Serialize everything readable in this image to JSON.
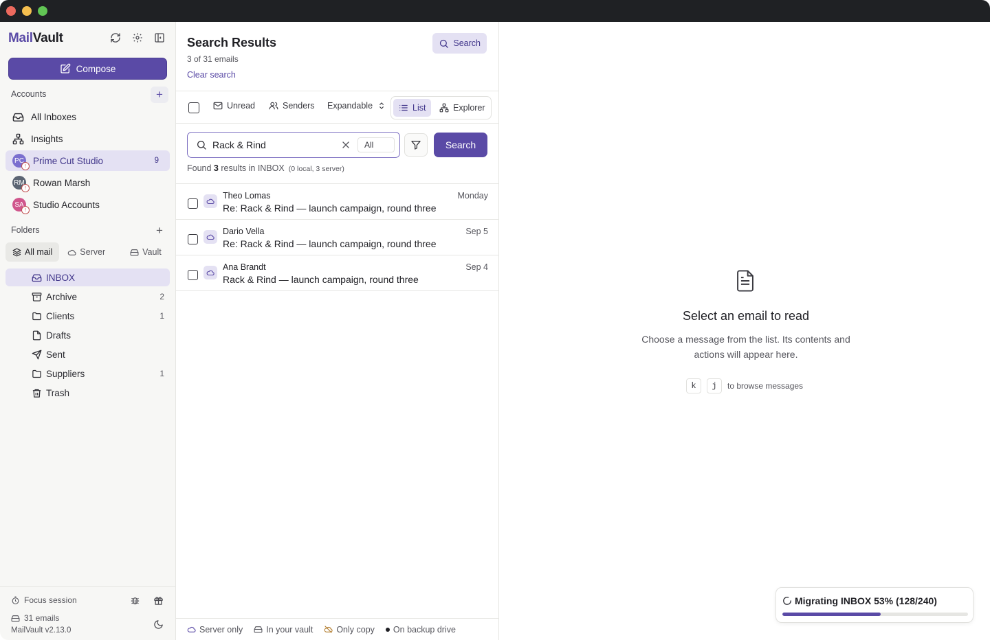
{
  "app": {
    "logo_mail": "Mail",
    "logo_vault": "Vault"
  },
  "sidebar": {
    "compose_label": "Compose",
    "accounts_label": "Accounts",
    "accounts": [
      {
        "label": "All Inboxes",
        "icon": "inbox-icon"
      },
      {
        "label": "Insights",
        "icon": "network-icon"
      },
      {
        "label": "Prime Cut Studio",
        "initials": "PC",
        "color": "#7b6fcf",
        "count": "9",
        "active": true
      },
      {
        "label": "Rowan Marsh",
        "initials": "RM",
        "color": "#5c6573"
      },
      {
        "label": "Studio Accounts",
        "initials": "SA",
        "color": "#d0568c"
      }
    ],
    "folders_label": "Folders",
    "folder_tabs": [
      "All mail",
      "Server",
      "Vault"
    ],
    "folders": [
      {
        "label": "INBOX",
        "icon": "inbox-icon",
        "count": ""
      },
      {
        "label": "Archive",
        "icon": "archive-icon",
        "count": "2"
      },
      {
        "label": "Clients",
        "icon": "folder-icon",
        "count": "1"
      },
      {
        "label": "Drafts",
        "icon": "file-icon",
        "count": ""
      },
      {
        "label": "Sent",
        "icon": "send-icon",
        "count": ""
      },
      {
        "label": "Suppliers",
        "icon": "folder-icon",
        "count": "1"
      },
      {
        "label": "Trash",
        "icon": "trash-icon",
        "count": ""
      }
    ],
    "footer": {
      "focus_label": "Focus session",
      "email_count": "31 emails",
      "version": "MailVault v2.13.0"
    }
  },
  "list": {
    "title": "Search Results",
    "subtitle": "3 of 31 emails",
    "clear_label": "Clear search",
    "top_search_label": "Search",
    "toolbar": {
      "unread": "Unread",
      "senders": "Senders",
      "expandable": "Expandable",
      "list": "List",
      "explorer": "Explorer"
    },
    "search": {
      "value": "Rack & Rind",
      "scope": "All",
      "button": "Search"
    },
    "found": {
      "prefix": "Found ",
      "count": "3",
      "suffix": " results in INBOX",
      "detail": "(0 local, 3 server)"
    },
    "rows": [
      {
        "sender": "Theo Lomas",
        "subject": "Re: Rack & Rind — launch campaign, round three",
        "date": "Monday"
      },
      {
        "sender": "Dario Vella",
        "subject": "Re: Rack & Rind — launch campaign, round three",
        "date": "Sep 5"
      },
      {
        "sender": "Ana Brandt",
        "subject": "Rack & Rind — launch campaign, round three",
        "date": "Sep 4"
      }
    ],
    "legend": {
      "server_only": "Server only",
      "in_vault": "In your vault",
      "only_copy": "Only copy",
      "backup": "On backup drive"
    }
  },
  "reader": {
    "empty_title": "Select an email to read",
    "empty_body": "Choose a message from the list. Its contents and actions will appear here.",
    "key_prev": "k",
    "key_next": "j",
    "browse_hint": "to browse messages"
  },
  "migration": {
    "text": "Migrating INBOX 53% (128/240)",
    "progress": 0.53
  },
  "colors": {
    "accent": "#5a4aa6",
    "accent_light": "#e4e1f3"
  }
}
